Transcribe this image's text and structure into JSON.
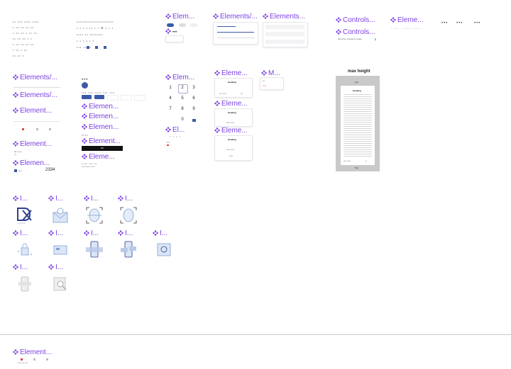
{
  "colors": {
    "accent": "#7b3fe4",
    "blue": "#3d5aa8",
    "grey": "#c9c9c9",
    "divider": "#c9cbd3"
  },
  "titles": {
    "elem_a": "Elem...",
    "elem_b": "Elements/...",
    "elem_c": "Elements...",
    "controls_a": "Controls...",
    "controls_b": "Controls...",
    "eleme_d": "Eleme...",
    "elements_slash_2": "Elements/...",
    "elements_slash_3": "Elements/...",
    "element_4": "Element...",
    "element_5": "Element...",
    "elemen_6": "Elemen...",
    "elem_7": "Elem...",
    "eleme_8": "Eleme...",
    "m_9": "M...",
    "elemen_10": "Elemen...",
    "elemen_11": "Elemen...",
    "elemen_12": "Elemen...",
    "element_13": "Element...",
    "eleme_14": "Eleme...",
    "eleme_15": "Eleme...",
    "eleme_16": "Eleme...",
    "el_17": "El...",
    "bottom": "Element..."
  },
  "max_height": {
    "title": "max height",
    "heading": "Heading",
    "top": "Top",
    "bottom": "Top"
  },
  "illustrations": {
    "titles": [
      "I...",
      "I...",
      "I...",
      "I...",
      "I...",
      "I...",
      "I...",
      "I...",
      "I...",
      "I...",
      "I..."
    ],
    "icons": [
      "dx-logo-icon",
      "envelope-icon",
      "face-scan-icon",
      "face-frame-icon",
      "lock-icon",
      "card-icon",
      "phone-shield-icon",
      "phone-cards-icon",
      "safe-icon",
      "phone-grey-icon",
      "search-grey-icon"
    ]
  },
  "numpad": {
    "keys": [
      "1",
      "2",
      "3",
      "4",
      "5",
      "6",
      "7",
      "8",
      "9",
      "0"
    ]
  },
  "cards": {
    "heading": "Heading",
    "dark_button": "OK"
  },
  "misc": {
    "amount": "2334",
    "controls_note": "Set price checkbox range"
  }
}
